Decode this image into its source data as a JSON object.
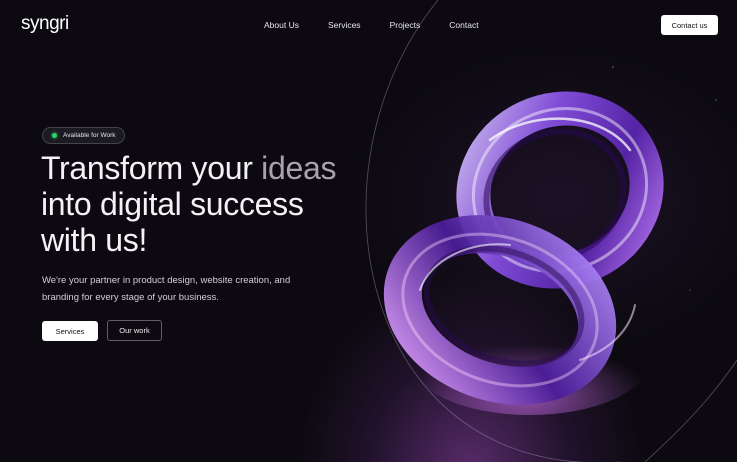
{
  "brand": {
    "logo": "syngri"
  },
  "nav": {
    "items": [
      {
        "label": "About Us"
      },
      {
        "label": "Services"
      },
      {
        "label": "Projects"
      },
      {
        "label": "Contact"
      }
    ],
    "cta_label": "Contact us"
  },
  "hero": {
    "badge": "Available for Work",
    "headline_line1_a": "Transform your ",
    "headline_line1_b": "ideas",
    "headline_line2": "into digital success",
    "headline_line3": "with us!",
    "subtext": "We're your partner in product design, website creation, and branding for every stage of your business.",
    "primary_button": "Services",
    "secondary_button": "Our work"
  },
  "colors": {
    "background": "#0c0a10",
    "accent": "#9a5cf0",
    "status_dot": "#2fd36b"
  },
  "icons": [
    "status-dot-icon",
    "abstract-3d-knot-illustration"
  ]
}
